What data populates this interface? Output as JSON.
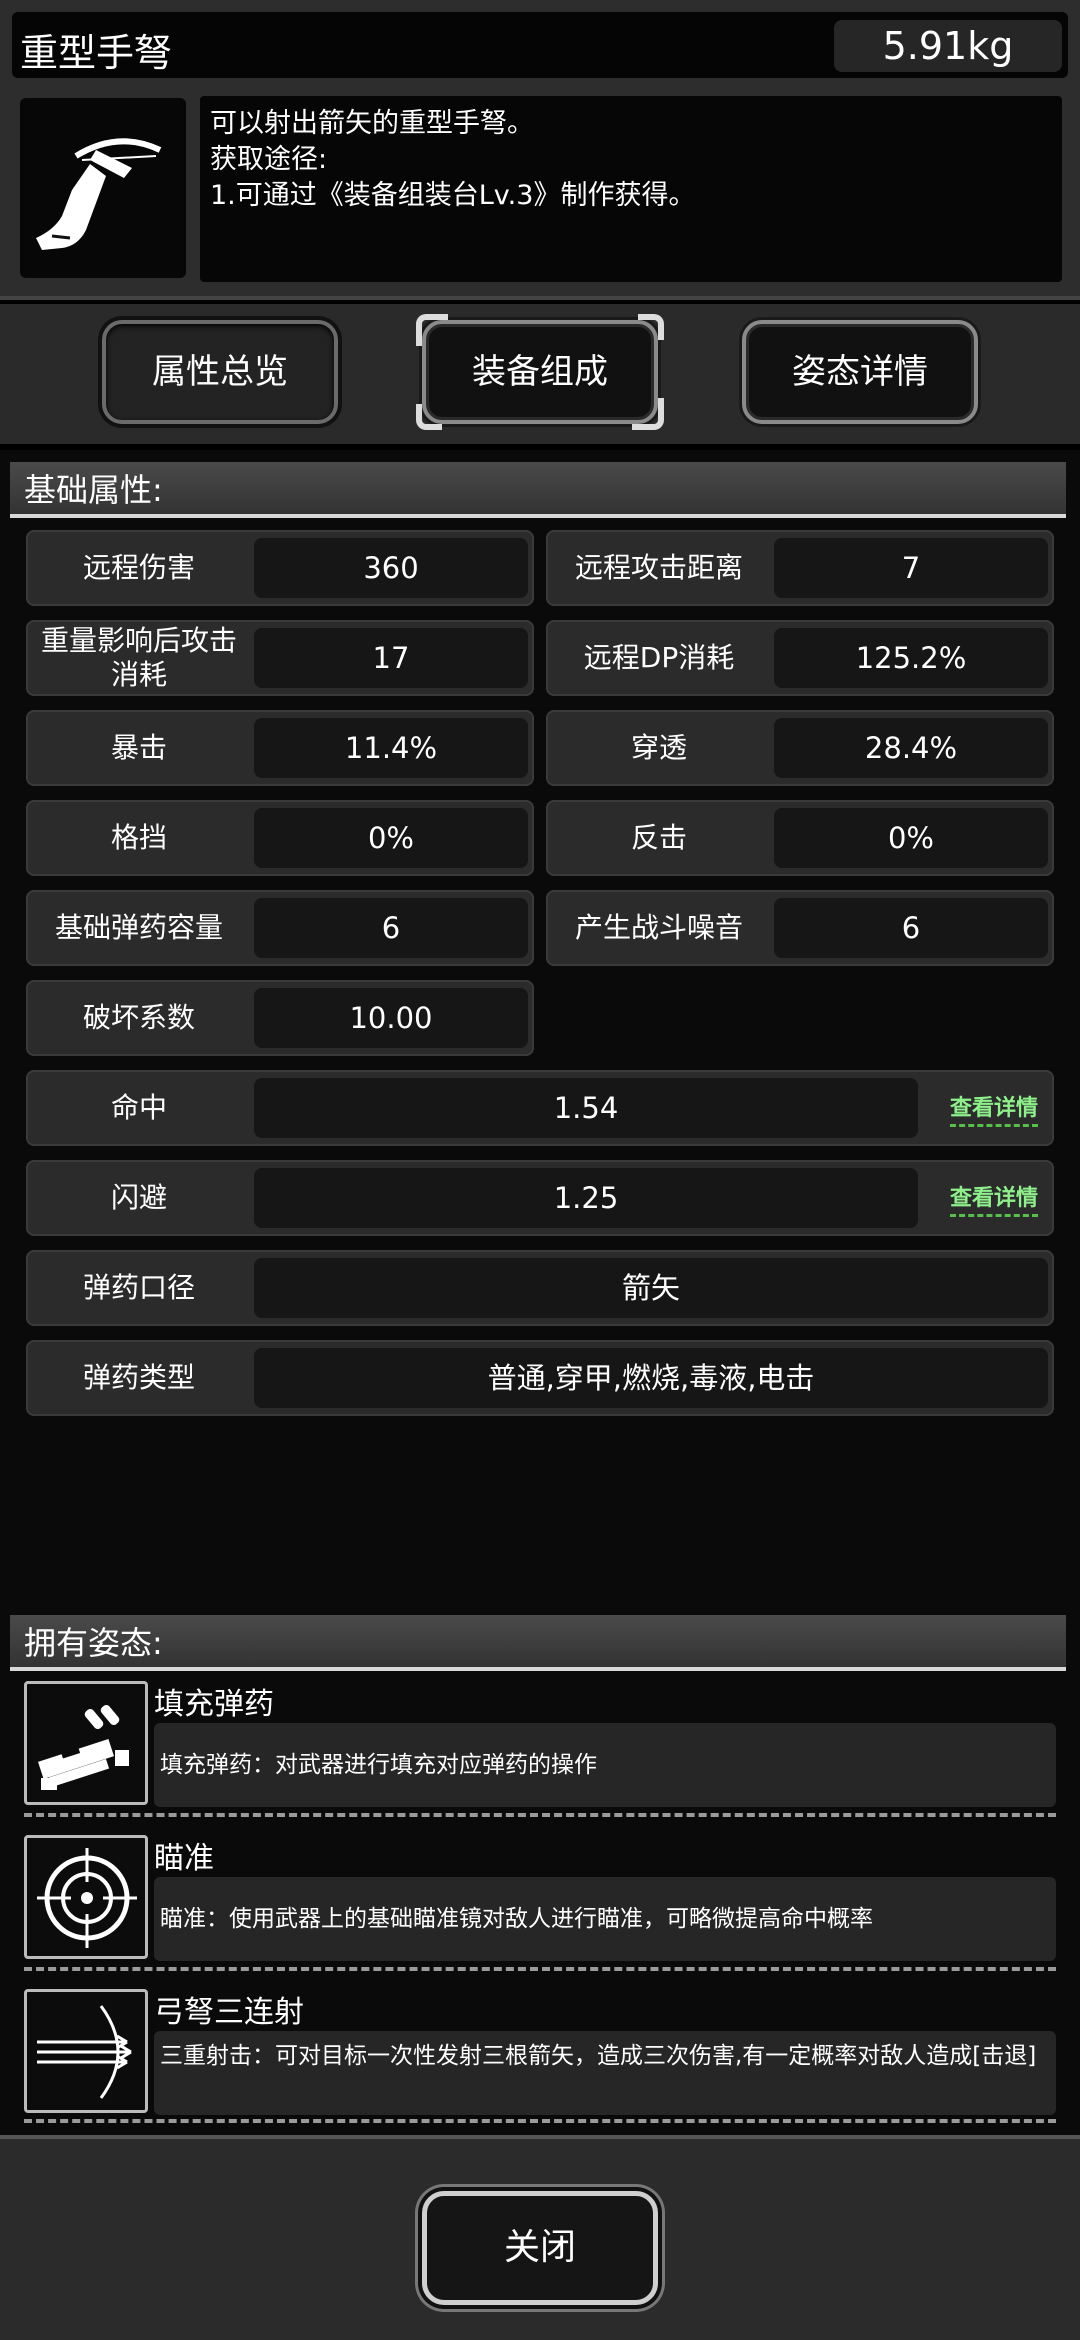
{
  "header": {
    "item_name": "重型手弩",
    "weight": "5.91kg",
    "desc_lines": [
      "可以射出箭矢的重型手弩。",
      "获取途径:",
      "1.可通过《装备组装台Lv.3》制作获得。"
    ]
  },
  "tabs": [
    {
      "label": "属性总览"
    },
    {
      "label": "装备组成"
    },
    {
      "label": "姿态详情"
    }
  ],
  "base_section": {
    "title": "基础属性:"
  },
  "attributes": {
    "grid": [
      {
        "label": "远程伤害",
        "value": "360"
      },
      {
        "label": "远程攻击距离",
        "value": "7"
      },
      {
        "label": "重量影响后攻击消耗",
        "value": "17"
      },
      {
        "label": "远程DP消耗",
        "value": "125.2%"
      },
      {
        "label": "暴击",
        "value": "11.4%"
      },
      {
        "label": "穿透",
        "value": "28.4%"
      },
      {
        "label": "格挡",
        "value": "0%"
      },
      {
        "label": "反击",
        "value": "0%"
      },
      {
        "label": "基础弹药容量",
        "value": "6"
      },
      {
        "label": "产生战斗噪音",
        "value": "6"
      },
      {
        "label": "破坏系数",
        "value": "10.00"
      }
    ],
    "wide": [
      {
        "label": "命中",
        "value": "1.54",
        "link": "查看详情"
      },
      {
        "label": "闪避",
        "value": "1.25",
        "link": "查看详情"
      },
      {
        "label": "弹药口径",
        "value": "箭矢"
      },
      {
        "label": "弹药类型",
        "value": "普通,穿甲,燃烧,毒液,电击"
      }
    ]
  },
  "pose_section": {
    "title": "拥有姿态:"
  },
  "poses": [
    {
      "name": "填充弹药",
      "desc": "填充弹药：对武器进行填充对应弹药的操作",
      "icon": "reload-ammo-icon"
    },
    {
      "name": "瞄准",
      "desc": "瞄准：使用武器上的基础瞄准镜对敌人进行瞄准，可略微提高命中概率",
      "icon": "crosshair-icon"
    },
    {
      "name": "弓弩三连射",
      "desc": "三重射击：可对目标一次性发射三根箭矢，造成三次伤害,有一定概率对敌人造成[击退]",
      "icon": "triple-arrow-icon"
    }
  ],
  "footer": {
    "close_label": "关闭"
  },
  "colors": {
    "detail_link": "#8df08a",
    "background": "#000000",
    "panel": "#2b2b2b"
  }
}
